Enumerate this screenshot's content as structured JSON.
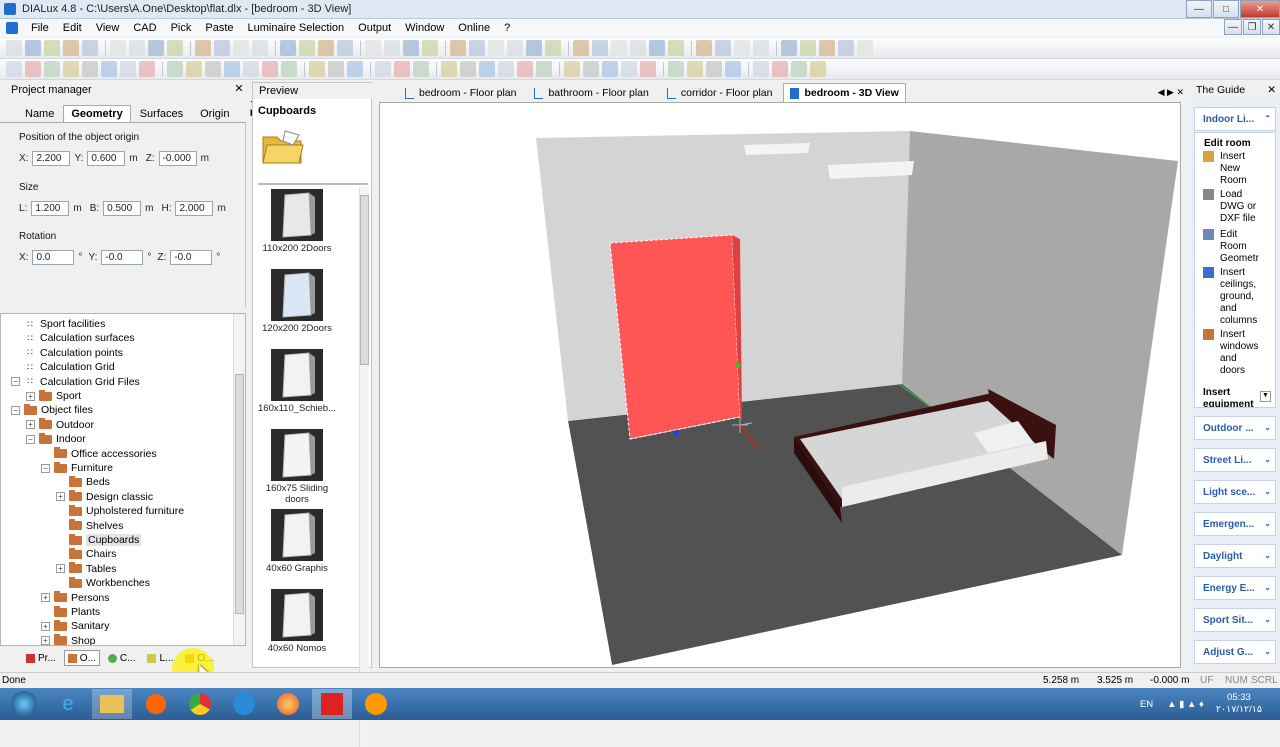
{
  "window": {
    "title": "DIALux 4.8 - C:\\Users\\A.One\\Desktop\\flat.dlx - [bedroom - 3D View]"
  },
  "menu": [
    "File",
    "Edit",
    "View",
    "CAD",
    "Pick",
    "Paste",
    "Luminaire Selection",
    "Output",
    "Window",
    "Online",
    "?"
  ],
  "project_manager": {
    "title": "Project manager",
    "tabs": [
      "Name",
      "Geometry",
      "Surfaces",
      "Origin"
    ],
    "active_tab": "Geometry",
    "position_label": "Position of the object origin",
    "size_label": "Size",
    "rotation_label": "Rotation",
    "position": {
      "x": "2.200",
      "y": "0.600",
      "z": "-0.000"
    },
    "size": {
      "l": "1.200",
      "b": "0.500",
      "h": "2.000"
    },
    "rotation": {
      "x": "0.0",
      "y": "-0.0",
      "z": "-0.0"
    },
    "unit": "m",
    "deg": "°",
    "labels": {
      "x": "X:",
      "y": "Y:",
      "z": "Z:",
      "l": "L:",
      "b": "B:",
      "h": "H:"
    }
  },
  "tree": [
    {
      "label": "Sport facilities",
      "level": 1,
      "icon": "sport-icon",
      "expander": ""
    },
    {
      "label": "Calculation surfaces",
      "level": 1,
      "icon": "calc-surface-icon",
      "expander": ""
    },
    {
      "label": "Calculation points",
      "level": 1,
      "icon": "calc-points-icon",
      "expander": ""
    },
    {
      "label": "Calculation Grid",
      "level": 1,
      "icon": "calc-grid-icon",
      "expander": ""
    },
    {
      "label": "Calculation Grid Files",
      "level": 1,
      "icon": "calc-grid-files-icon",
      "expander": "−"
    },
    {
      "label": "Sport",
      "level": 2,
      "icon": "folder",
      "expander": "+"
    },
    {
      "label": "Object files",
      "level": 1,
      "icon": "folder",
      "expander": "−"
    },
    {
      "label": "Outdoor",
      "level": 2,
      "icon": "folder",
      "expander": "+"
    },
    {
      "label": "Indoor",
      "level": 2,
      "icon": "folder",
      "expander": "−"
    },
    {
      "label": "Office accessories",
      "level": 3,
      "icon": "folder",
      "expander": ""
    },
    {
      "label": "Furniture",
      "level": 3,
      "icon": "folder",
      "expander": "−"
    },
    {
      "label": "Beds",
      "level": 4,
      "icon": "folder",
      "expander": ""
    },
    {
      "label": "Design classic",
      "level": 4,
      "icon": "folder",
      "expander": "+"
    },
    {
      "label": "Upholstered furniture",
      "level": 4,
      "icon": "folder",
      "expander": ""
    },
    {
      "label": "Shelves",
      "level": 4,
      "icon": "folder",
      "expander": ""
    },
    {
      "label": "Cupboards",
      "level": 4,
      "icon": "folder",
      "expander": "",
      "selected": true
    },
    {
      "label": "Chairs",
      "level": 4,
      "icon": "folder",
      "expander": ""
    },
    {
      "label": "Tables",
      "level": 4,
      "icon": "folder",
      "expander": "+"
    },
    {
      "label": "Workbenches",
      "level": 4,
      "icon": "folder",
      "expander": ""
    },
    {
      "label": "Persons",
      "level": 3,
      "icon": "folder",
      "expander": "+"
    },
    {
      "label": "Plants",
      "level": 3,
      "icon": "folder",
      "expander": ""
    },
    {
      "label": "Sanitary",
      "level": 3,
      "icon": "folder",
      "expander": "+"
    },
    {
      "label": "Shop",
      "level": 3,
      "icon": "folder",
      "expander": "+"
    }
  ],
  "left_bottom_tabs": [
    "Pr...",
    "O...",
    "C...",
    "L...",
    "O..."
  ],
  "preview": {
    "title": "Preview",
    "folder_label": "Cupboards",
    "items": [
      "110x200 2Doors",
      "120x200 2Doors",
      "160x110_Schieb...",
      "160x75 Sliding doors",
      "40x60 Graphis",
      "40x60 Nomos"
    ]
  },
  "view_tabs": [
    "bedroom - Floor plan",
    "bathroom - Floor plan",
    "corridor - Floor plan",
    "bedroom - 3D View"
  ],
  "active_view_tab": "bedroom - 3D View",
  "guide": {
    "title": "The Guide",
    "top_section": "Indoor Li...",
    "edit_room": "Edit room",
    "items": [
      "Insert New Room",
      "Load DWG or DXF file",
      "Edit Room Geometr",
      "Insert ceilings, ground, and columns",
      "Insert windows and doors"
    ],
    "insert_equipment": "Insert equipment",
    "sections": [
      "Outdoor ...",
      "Street Li...",
      "Light sce...",
      "Emergen...",
      "Daylight",
      "Energy E...",
      "Sport Sit...",
      "Adjust G..."
    ]
  },
  "status": {
    "text": "Done",
    "x": "5.258 m",
    "y": "3.525 m",
    "z": "-0.000 m",
    "uf": "UF",
    "num": "NUM",
    "scrl": "SCRL"
  },
  "taskbar": {
    "lang": "EN",
    "time": "05:33",
    "date": "۲۰۱۷/۱۲/۱۵"
  },
  "colors": {
    "selected_object": "#ff5555",
    "accent": "#1f6fd1"
  }
}
